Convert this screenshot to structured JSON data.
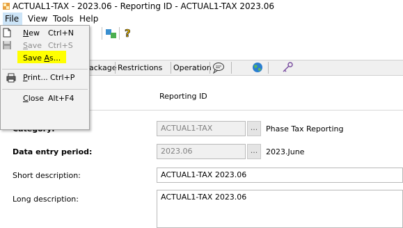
{
  "window": {
    "title": "ACTUAL1-TAX - 2023.06 - Reporting ID - ACTUAL1-TAX  2023.06"
  },
  "menubar": {
    "items": [
      "File",
      "View",
      "Tools",
      "Help"
    ]
  },
  "file_menu": {
    "items": [
      {
        "label": "New",
        "shortcut": "Ctrl+N",
        "icon": "new-document-icon",
        "enabled": true
      },
      {
        "label": "Save",
        "shortcut": "Ctrl+S",
        "icon": "save-icon",
        "enabled": false
      },
      {
        "label": "Save As...",
        "shortcut": "",
        "icon": "",
        "enabled": true,
        "highlighted": true
      },
      {
        "label": "Print...",
        "shortcut": "Ctrl+P",
        "icon": "printer-icon",
        "enabled": true
      },
      {
        "label": "Close",
        "shortcut": "Alt+F4",
        "icon": "",
        "enabled": true
      }
    ],
    "highlight_color": "#ffff00"
  },
  "tabs": {
    "items": [
      "ackage",
      "Restrictions",
      "Operation"
    ]
  },
  "form": {
    "reporting_id_label": "Reporting ID",
    "category_label": "Category:",
    "category_value": "ACTUAL1-TAX",
    "category_description": "Phase Tax Reporting",
    "period_label": "Data entry period:",
    "period_value": "2023.06",
    "period_description": "2023.June",
    "short_desc_label": "Short description:",
    "short_desc_value": "ACTUAL1-TAX  2023.06",
    "long_desc_label": "Long description:",
    "long_desc_value": "ACTUAL1-TAX  2023.06",
    "dots_button": "..."
  }
}
